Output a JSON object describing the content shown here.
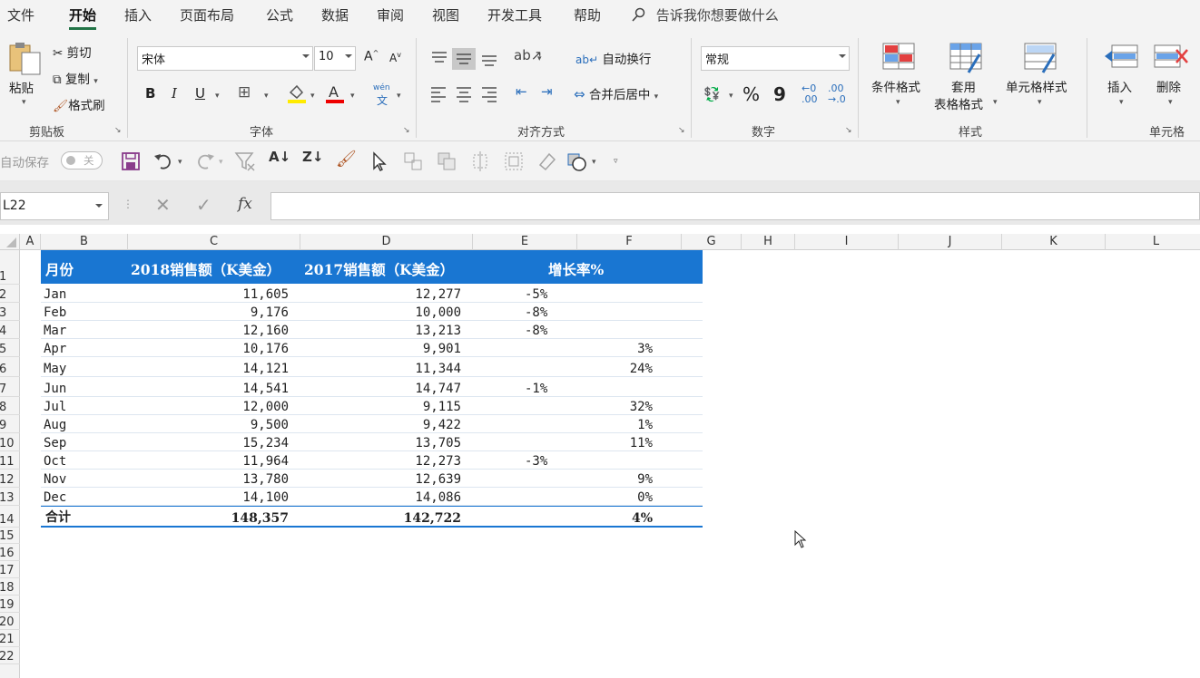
{
  "menu": {
    "tabs": [
      "文件",
      "开始",
      "插入",
      "页面布局",
      "公式",
      "数据",
      "审阅",
      "视图",
      "开发工具",
      "帮助"
    ],
    "tell_me": "告诉我你想要做什么"
  },
  "ribbon": {
    "clipboard": {
      "paste": "粘贴",
      "cut": "剪切",
      "copy": "复制",
      "format_painter": "格式刷",
      "label": "剪贴板"
    },
    "font": {
      "name": "宋体",
      "size": "10",
      "bold": "B",
      "italic": "I",
      "underline": "U",
      "label": "字体",
      "phonetic": "wén"
    },
    "alignment": {
      "wrap": "自动换行",
      "merge": "合并后居中",
      "label": "对齐方式"
    },
    "number": {
      "format": "常规",
      "percent": "%",
      "comma": "9",
      "label": "数字"
    },
    "styles": {
      "conditional": "条件格式",
      "table_line1": "套用",
      "table_line2": "表格格式",
      "cell_styles": "单元格样式",
      "label": "样式"
    },
    "cells": {
      "insert": "插入",
      "delete": "删除",
      "label": "单元格"
    }
  },
  "qat": {
    "autosave": "自动保存",
    "toggle": "关"
  },
  "formula_bar": {
    "name_box": "L22",
    "fx": "fx",
    "content": ""
  },
  "columns": [
    "A",
    "B",
    "C",
    "D",
    "E",
    "F",
    "G",
    "H",
    "I",
    "J",
    "K",
    "L"
  ],
  "rows": [
    "1",
    "2",
    "3",
    "4",
    "5",
    "6",
    "7",
    "8",
    "9",
    "10",
    "11",
    "12",
    "13",
    "14",
    "15",
    "16",
    "17",
    "18",
    "19",
    "20",
    "21",
    "22"
  ],
  "table": {
    "headers": [
      "月份",
      "2018销售额（K美金）",
      "2017销售额（K美金）",
      "增长率%"
    ],
    "data": [
      {
        "month": "Jan",
        "y2018": "11,605",
        "y2017": "12,277",
        "neg": "-5%",
        "pos": ""
      },
      {
        "month": "Feb",
        "y2018": "9,176",
        "y2017": "10,000",
        "neg": "-8%",
        "pos": ""
      },
      {
        "month": "Mar",
        "y2018": "12,160",
        "y2017": "13,213",
        "neg": "-8%",
        "pos": ""
      },
      {
        "month": "Apr",
        "y2018": "10,176",
        "y2017": "9,901",
        "neg": "",
        "pos": "3%"
      },
      {
        "month": "May",
        "y2018": "14,121",
        "y2017": "11,344",
        "neg": "",
        "pos": "24%"
      },
      {
        "month": "Jun",
        "y2018": "14,541",
        "y2017": "14,747",
        "neg": "-1%",
        "pos": ""
      },
      {
        "month": "Jul",
        "y2018": "12,000",
        "y2017": "9,115",
        "neg": "",
        "pos": "32%"
      },
      {
        "month": "Aug",
        "y2018": "9,500",
        "y2017": "9,422",
        "neg": "",
        "pos": "1%"
      },
      {
        "month": "Sep",
        "y2018": "15,234",
        "y2017": "13,705",
        "neg": "",
        "pos": "11%"
      },
      {
        "month": "Oct",
        "y2018": "11,964",
        "y2017": "12,273",
        "neg": "-3%",
        "pos": ""
      },
      {
        "month": "Nov",
        "y2018": "13,780",
        "y2017": "12,639",
        "neg": "",
        "pos": "9%"
      },
      {
        "month": "Dec",
        "y2018": "14,100",
        "y2017": "14,086",
        "neg": "",
        "pos": "0%"
      }
    ],
    "total": {
      "label": "合计",
      "y2018": "148,357",
      "y2017": "142,722",
      "growth": "4%"
    }
  },
  "colors": {
    "accent": "#1976d2",
    "excel_green": "#217346"
  }
}
